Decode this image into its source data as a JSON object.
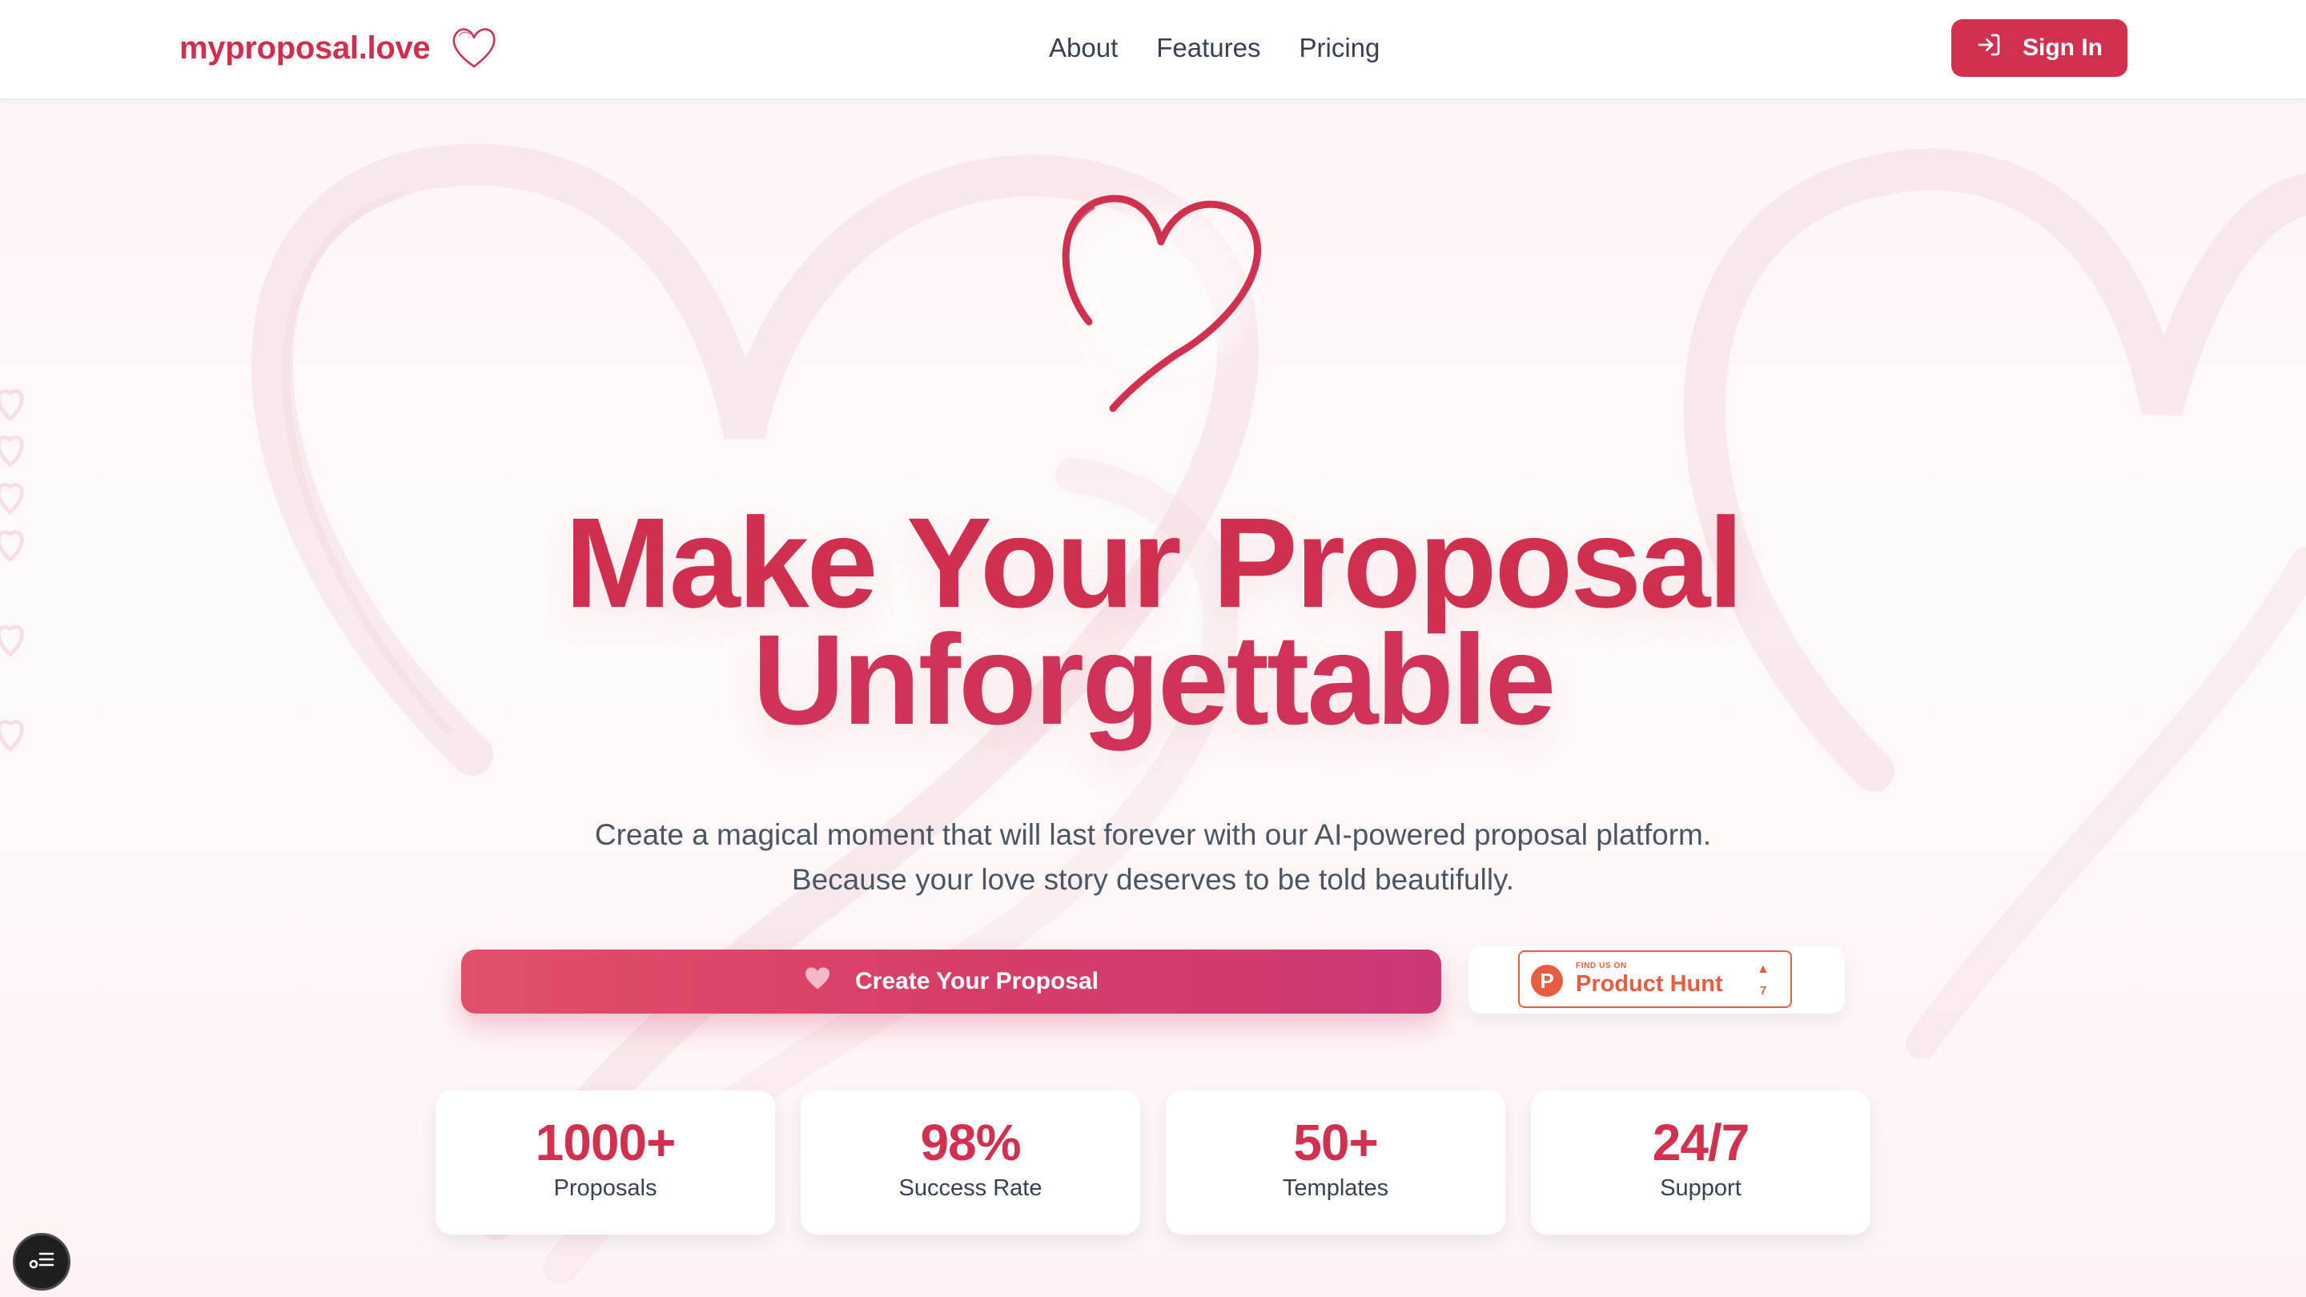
{
  "brand": {
    "name": "myproposal.love",
    "icon": "heart-outline-icon"
  },
  "nav": {
    "links": [
      "About",
      "Features",
      "Pricing"
    ],
    "sign_in": "Sign In",
    "sign_in_icon": "login-icon"
  },
  "hero": {
    "icon": "heart-brush-icon",
    "title_line1": "Make Your Proposal",
    "title_line2": "Unforgettable",
    "subtitle_line1": "Create a magical moment that will last forever with our AI-powered proposal platform.",
    "subtitle_line2": "Because your love story deserves to be told beautifully."
  },
  "cta": {
    "label": "Create Your Proposal",
    "icon": "heart-icon"
  },
  "product_hunt": {
    "small_label": "FIND US ON",
    "name": "Product Hunt",
    "logo_letter": "P",
    "upvote_icon": "triangle-up-icon",
    "upvotes": "7"
  },
  "stats": [
    {
      "value": "1000+",
      "label": "Proposals"
    },
    {
      "value": "98%",
      "label": "Success Rate"
    },
    {
      "value": "50+",
      "label": "Templates"
    },
    {
      "value": "24/7",
      "label": "Support"
    }
  ],
  "colors": {
    "brand": "#d1304f",
    "cta_start": "#e0506a",
    "cta_end": "#cc3776",
    "product_hunt": "#e75d40"
  },
  "floating_button_icon": "menu-list-icon"
}
